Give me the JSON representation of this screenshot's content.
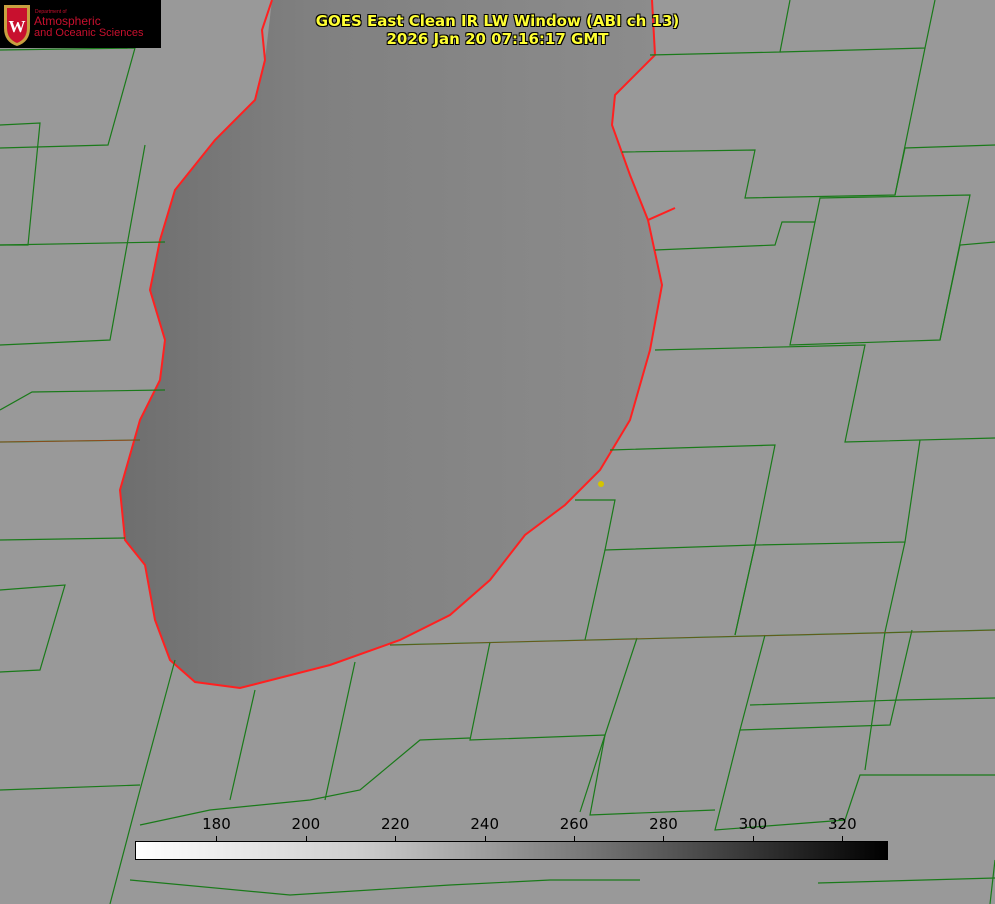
{
  "title": {
    "line1": "GOES East Clean IR LW Window (ABI ch 13)",
    "line2": "2026 Jan 20 07:16:17 GMT"
  },
  "logo": {
    "line1": "Department of",
    "line2": "Atmospheric",
    "line3": "and Oceanic Sciences",
    "icon": "university-crest-w"
  },
  "colorbar": {
    "ticks": [
      180,
      200,
      220,
      240,
      260,
      280,
      300,
      320
    ],
    "range": [
      162,
      330
    ],
    "colormap": "white-to-black"
  },
  "colors": {
    "background": "#999999",
    "lake": "#7f7f7f",
    "county_lines": "#1a7a1a",
    "coastline": "#ff2020",
    "title": "#ffff33",
    "marker": "#d4c400"
  }
}
